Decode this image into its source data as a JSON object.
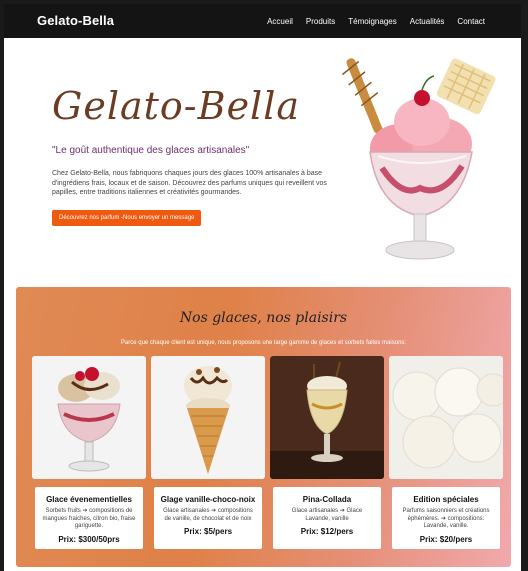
{
  "nav": {
    "brand": "Gelato-Bella",
    "links": [
      "Accueil",
      "Produits",
      "Témoignages",
      "Actualités",
      "Contact"
    ]
  },
  "hero": {
    "title": "Gelato-Bella",
    "tagline": "\"Le goût authentique des glaces artisanales\"",
    "description": "Chez Gelato-Bella, nous fabriquons chaques jours des glaces 100% artisanales à base d'ingrédiens frais, locaux et de saison. Découvrez des parfums uniques qui reveillent vos papilles, entre traditions italiennes et créativités gourmandes.",
    "button_label": "Découvrez nos parfum -Nous envoyer un message"
  },
  "products": {
    "title": "Nos glaces, nos plaisirs",
    "subtitle": "Parce que chaque client est unique, nous proposons une large gamme de glaces et sorbets faites maisons:",
    "items": [
      {
        "name": "Glace évenementielles",
        "desc": "Sorbets fruits ➔ compositions de mangues fraiches, citron bio, fraise gariguette.",
        "price": "Prix: $300/50prs"
      },
      {
        "name": "Glage vanille-choco-noix",
        "desc": "Glace artisanales ➔ compositions de vanille, de chocolat et de noix",
        "price": "Prix: $5/pers"
      },
      {
        "name": "Pina-Collada",
        "desc": "Glace artisanales ➔ Glace Lavande, vanille",
        "price": "Prix: $12/pers"
      },
      {
        "name": "Edition spéciales",
        "desc": "Parfums saisonniers et créations éphémères. ➔ compositions: Lavande, vanille.",
        "price": "Prix: $20/pers"
      }
    ]
  },
  "colors": {
    "nav_bg": "#141414",
    "accent_orange": "#ef5a10",
    "title_brown": "#6b3b22",
    "tagline_purple": "#6b2f6b"
  }
}
